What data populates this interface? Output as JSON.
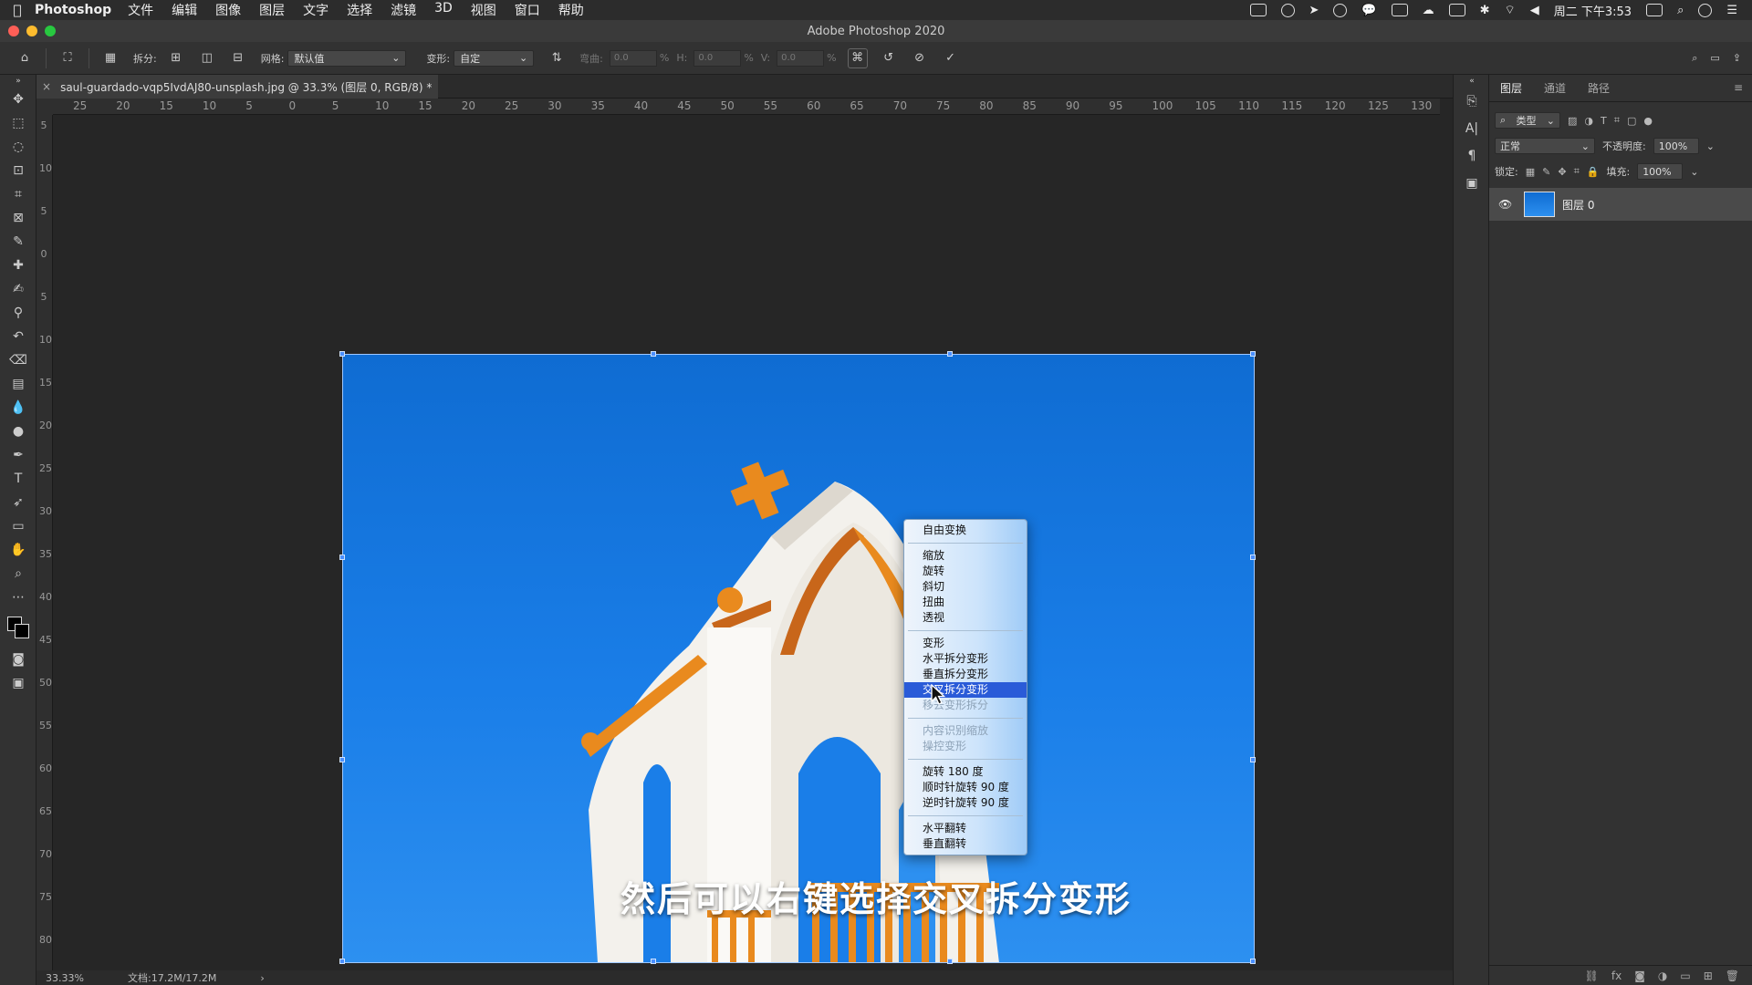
{
  "menubar": {
    "app": "Photoshop",
    "items": [
      "文件",
      "编辑",
      "图像",
      "图层",
      "文字",
      "选择",
      "滤镜",
      "3D",
      "视图",
      "窗口",
      "帮助"
    ],
    "clock": "周二 下午3:53"
  },
  "window": {
    "title": "Adobe Photoshop 2020"
  },
  "options": {
    "split_label": "拆分:",
    "grid_label": "网格:",
    "grid_value": "默认值",
    "warp_label": "变形:",
    "warp_value": "自定",
    "bend_label": "弯曲:",
    "bend_value": "0.0",
    "h_label": "H:",
    "h_value": "0.0",
    "v_label": "V:",
    "v_value": "0.0",
    "percent": "%"
  },
  "document": {
    "tab_title": "saul-guardado-vqp5IvdAJ80-unsplash.jpg @ 33.3% (图层 0, RGB/8) *"
  },
  "ruler": {
    "h_ticks": [
      "25",
      "20",
      "15",
      "10",
      "5",
      "0",
      "5",
      "10",
      "15",
      "20",
      "25",
      "30",
      "35",
      "40",
      "45",
      "50",
      "55",
      "60",
      "65",
      "70",
      "75",
      "80",
      "85",
      "90",
      "95",
      "100",
      "105",
      "110",
      "115",
      "120",
      "125",
      "130"
    ],
    "v_ticks": [
      "5",
      "10",
      "5",
      "0",
      "5",
      "10",
      "15",
      "20",
      "25",
      "30",
      "35",
      "40",
      "45",
      "50",
      "55",
      "60",
      "65",
      "70",
      "75",
      "80"
    ]
  },
  "context_menu": {
    "groups": [
      [
        {
          "label": "自由变换",
          "state": "normal"
        }
      ],
      [
        {
          "label": "缩放",
          "state": "normal"
        },
        {
          "label": "旋转",
          "state": "normal"
        },
        {
          "label": "斜切",
          "state": "normal"
        },
        {
          "label": "扭曲",
          "state": "normal"
        },
        {
          "label": "透视",
          "state": "normal"
        }
      ],
      [
        {
          "label": "变形",
          "state": "normal"
        },
        {
          "label": "水平拆分变形",
          "state": "normal"
        },
        {
          "label": "垂直拆分变形",
          "state": "normal"
        },
        {
          "label": "交叉拆分变形",
          "state": "active"
        },
        {
          "label": "移去变形拆分",
          "state": "disabled"
        }
      ],
      [
        {
          "label": "内容识别缩放",
          "state": "disabled"
        },
        {
          "label": "操控变形",
          "state": "disabled"
        }
      ],
      [
        {
          "label": "旋转 180 度",
          "state": "normal"
        },
        {
          "label": "顺时针旋转 90 度",
          "state": "normal"
        },
        {
          "label": "逆时针旋转 90 度",
          "state": "normal"
        }
      ],
      [
        {
          "label": "水平翻转",
          "state": "normal"
        },
        {
          "label": "垂直翻转",
          "state": "normal"
        }
      ]
    ]
  },
  "subtitle": "然后可以右键选择交叉拆分变形",
  "status": {
    "zoom": "33.33%",
    "doc": "文档:17.2M/17.2M",
    "arrow": "›"
  },
  "layers": {
    "tabs": [
      "图层",
      "通道",
      "路径"
    ],
    "filter_value": "类型",
    "blend_mode": "正常",
    "opacity_label": "不透明度:",
    "opacity_value": "100%",
    "lock_label": "锁定:",
    "fill_label": "填充:",
    "fill_value": "100%",
    "layer_name": "图层 0"
  },
  "colors": {
    "accent": "#2a5bd8",
    "sky": "#1a7ee8",
    "orange": "#e98a1e"
  }
}
